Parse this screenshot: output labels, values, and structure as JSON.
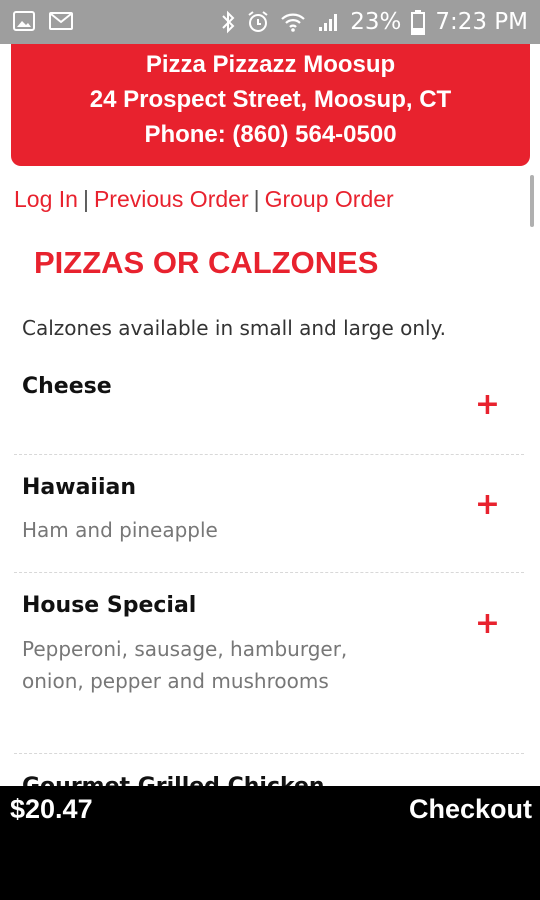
{
  "status_bar": {
    "battery": "23%",
    "time": "7:23 PM",
    "icons": [
      "gallery-icon",
      "gmail-icon",
      "bluetooth-icon",
      "alarm-icon",
      "wifi-icon",
      "signal-icon",
      "battery-icon"
    ]
  },
  "restaurant": {
    "name": "Pizza Pizzazz Moosup",
    "address": "24 Prospect Street, Moosup, CT",
    "phone": "Phone: (860) 564-0500"
  },
  "nav_links": {
    "login": "Log In",
    "separator": "|",
    "previous_order": "Previous Order",
    "group_order": "Group Order"
  },
  "section": {
    "title": "PIZZAS OR CALZONES",
    "note": "Calzones available in small and large only."
  },
  "items": [
    {
      "name": "Cheese",
      "description": ""
    },
    {
      "name": "Hawaiian",
      "description": "Ham and pineapple"
    },
    {
      "name": "House Special",
      "description": "Pepperoni, sausage, hamburger, onion, pepper and mushrooms"
    },
    {
      "name": "Gourmet Grilled Chicken",
      "description": ""
    }
  ],
  "add_symbol": "+",
  "cart": {
    "total": "$20.47",
    "checkout_label": "Checkout"
  },
  "colors": {
    "brand_red": "#e8222e",
    "status_bar": "#9e9e9e",
    "cart_bar": "#000000"
  }
}
